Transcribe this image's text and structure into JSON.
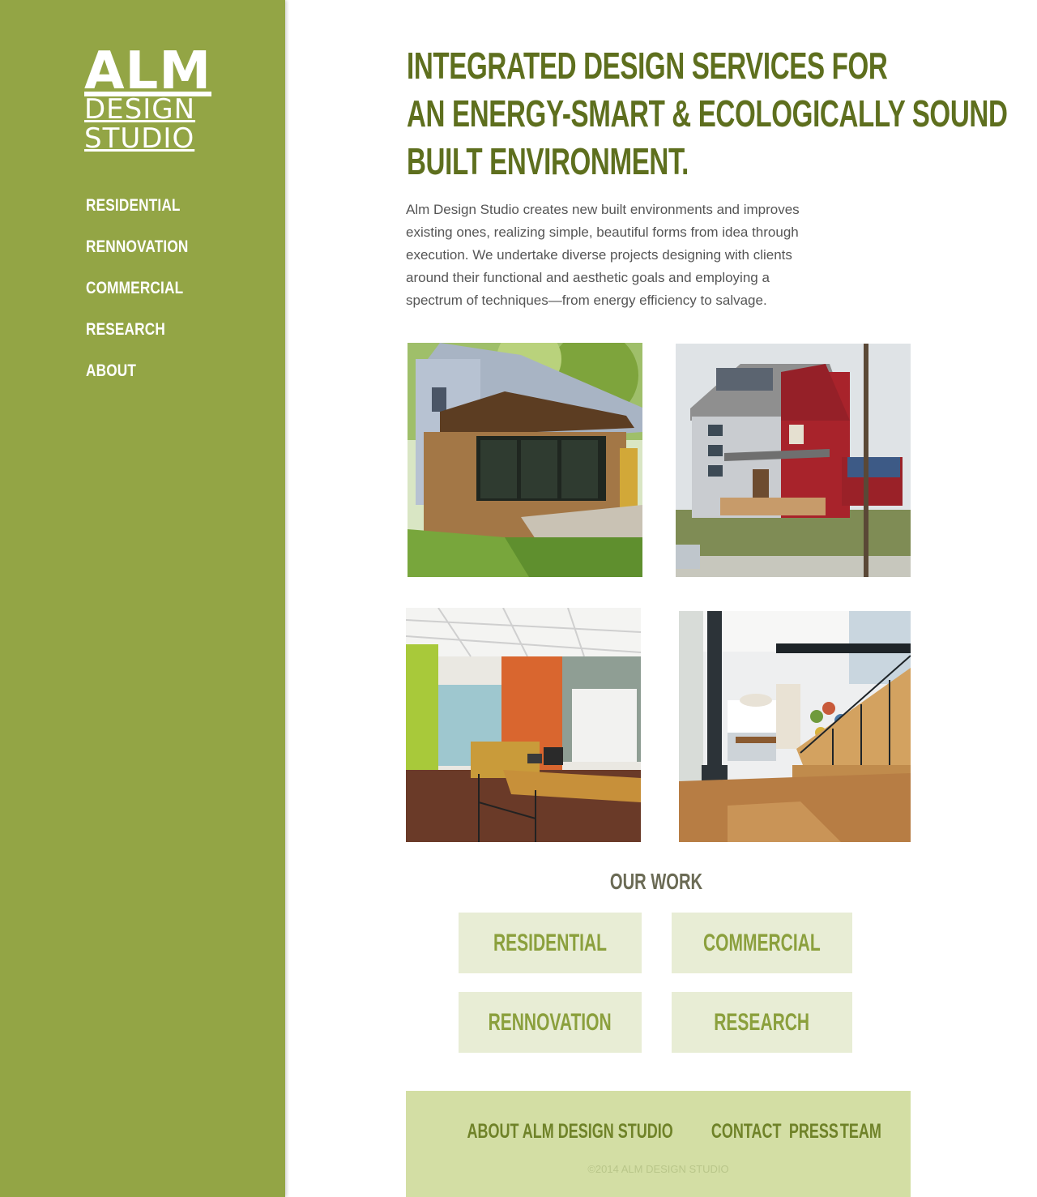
{
  "brand": {
    "line1": "ALM",
    "line2": "DESIGN",
    "line3": "STUDIO"
  },
  "sidebar": {
    "items": [
      {
        "label": "RESIDENTIAL"
      },
      {
        "label": "RENNOVATION"
      },
      {
        "label": "COMMERCIAL"
      },
      {
        "label": "RESEARCH"
      },
      {
        "label": "ABOUT"
      }
    ]
  },
  "hero": {
    "line1": "INTEGRATED DESIGN SERVICES FOR",
    "line2": "AN ENERGY-SMART & ECOLOGICALLY SOUND",
    "line3": "BUILT ENVIRONMENT.",
    "intro": "Alm Design Studio creates new built environments and improves existing ones, realizing simple, beautiful forms from idea through execution. We undertake diverse projects designing with clients around their functional and aesthetic goals and employing a spectrum of techniques—from energy efficiency to salvage."
  },
  "work": {
    "title": "OUR WORK",
    "buttons": [
      {
        "label": "RESIDENTIAL"
      },
      {
        "label": "COMMERCIAL"
      },
      {
        "label": "RENNOVATION"
      },
      {
        "label": "RESEARCH"
      }
    ]
  },
  "footer": {
    "links": [
      {
        "label": "ABOUT ALM DESIGN STUDIO"
      },
      {
        "label": "CONTACT"
      },
      {
        "label": "PRESS"
      },
      {
        "label": "TEAM"
      }
    ],
    "copyright": "©2014 ALM DESIGN STUDIO"
  },
  "colors": {
    "sidebar": "#93a545",
    "headline": "#5e6f1e",
    "button_bg": "#e8edd5",
    "button_text": "#8ba03d",
    "footer_bg": "#d3dea4"
  }
}
